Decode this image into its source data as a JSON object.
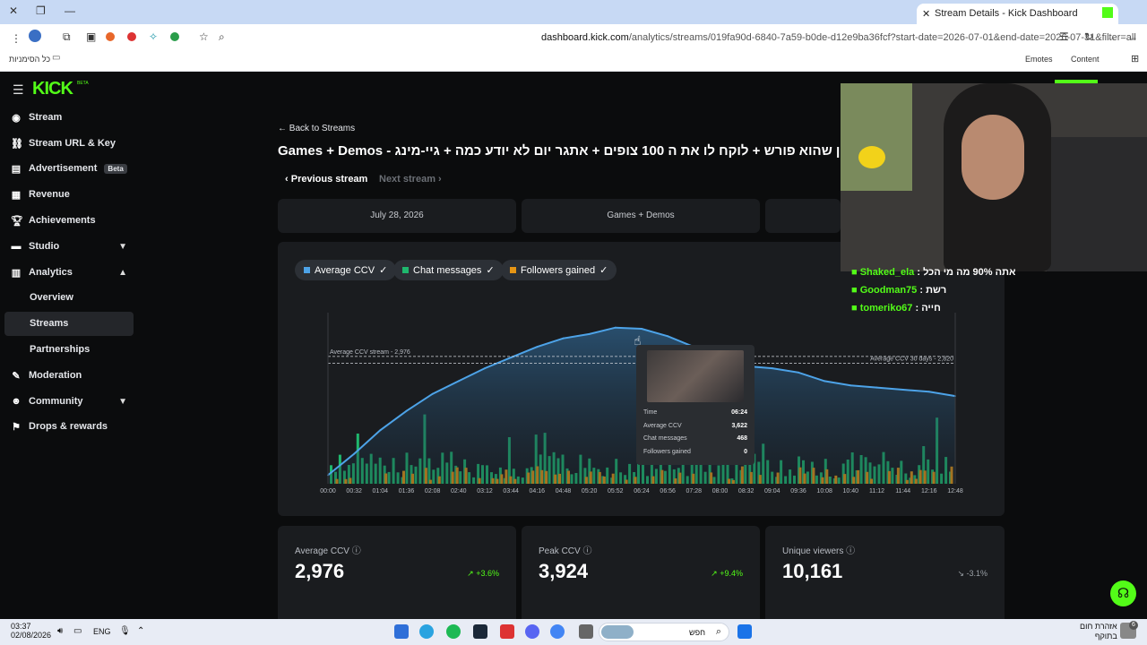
{
  "browser": {
    "tab_title": "Stream Details - Kick Dashboard",
    "url_domain": "dashboard.kick.com",
    "url_path": "/analytics/streams/019fa90d-6840-7a59-b0de-d12e9ba36fcf?start-date=2026-07-01&end-date=2026-07-31&filter=all",
    "bookmarks_label": "כל הסימניות",
    "right_links": [
      "Emotes",
      "Content"
    ]
  },
  "brand": {
    "logo": "KICK",
    "badge": "BETA"
  },
  "sidebar": {
    "items": [
      {
        "label": "Stream",
        "icon": "broadcast-icon"
      },
      {
        "label": "Stream URL & Key",
        "icon": "link-icon"
      },
      {
        "label": "Advertisement",
        "icon": "ad-icon",
        "badge": "Beta"
      },
      {
        "label": "Revenue",
        "icon": "revenue-icon"
      },
      {
        "label": "Achievements",
        "icon": "trophy-icon"
      },
      {
        "label": "Studio",
        "icon": "studio-icon"
      },
      {
        "label": "Analytics",
        "icon": "analytics-icon"
      },
      {
        "label": "Moderation",
        "icon": "wrench-icon"
      },
      {
        "label": "Community",
        "icon": "community-icon"
      },
      {
        "label": "Drops & rewards",
        "icon": "drops-icon"
      }
    ],
    "analytics_sub": [
      "Overview",
      "Streams",
      "Partnerships"
    ]
  },
  "page": {
    "back": "Back to Streams",
    "title": "Games + Demos - אני לא מאמין שהוא פורש + לוקח לו את ה 100 צופים + אתגר יום לא יודע כמה + גיי-מינג",
    "prev": "Previous stream",
    "next": "Next stream",
    "info": [
      "July 28, 2026",
      "Games + Demos"
    ]
  },
  "filters": [
    "Average CCV",
    "Chat messages",
    "Followers gained"
  ],
  "colors": {
    "ccv": "#4da3e8",
    "chat": "#1fb86e",
    "followers": "#e69514",
    "accent": "#53fc18"
  },
  "chart_data": {
    "type": "line",
    "x": [
      "00:00",
      "00:32",
      "01:04",
      "01:36",
      "02:08",
      "02:40",
      "03:12",
      "03:44",
      "04:16",
      "04:48",
      "05:20",
      "05:52",
      "06:24",
      "06:56",
      "07:28",
      "08:00",
      "08:32",
      "09:04",
      "09:36",
      "10:08",
      "10:40",
      "11:12",
      "11:44",
      "12:16",
      "12:48"
    ],
    "series": [
      {
        "name": "Average CCV",
        "values": [
          200,
          700,
          1250,
          1700,
          2100,
          2400,
          2700,
          2950,
          3200,
          3400,
          3500,
          3650,
          3622,
          3450,
          3200,
          2850,
          2750,
          2700,
          2600,
          2400,
          2300,
          2250,
          2200,
          2150,
          2050
        ]
      }
    ],
    "reference_lines": [
      {
        "label": "Average CCV stream - 2,976",
        "value": 2976
      },
      {
        "label": "Average CCV 30 days - 2,820",
        "value": 2820
      }
    ],
    "ylim": [
      0,
      4000
    ]
  },
  "tooltip": {
    "rows": [
      {
        "k": "Time",
        "v": "06:24"
      },
      {
        "k": "Average CCV",
        "v": "3,622"
      },
      {
        "k": "Chat messages",
        "v": "468"
      },
      {
        "k": "Followers gained",
        "v": "0"
      }
    ]
  },
  "stats": [
    {
      "label": "Average CCV",
      "value": "2,976",
      "delta": "+3.6%"
    },
    {
      "label": "Peak CCV",
      "value": "3,924",
      "delta": "+9.4%"
    },
    {
      "label": "Unique viewers",
      "value": "10,161",
      "delta": "-3.1%"
    }
  ],
  "chat": [
    {
      "user": "Shaked_ela",
      "msg": "אתה 90% מה מי הכל"
    },
    {
      "user": "Goodman75",
      "msg": "רשת"
    },
    {
      "user": "tomeriko67",
      "msg": "חייה"
    }
  ],
  "taskbar": {
    "time": "03:37",
    "date": "02/08/2026",
    "lang": "ENG",
    "search": "חפש",
    "weather": "אזהרת חום",
    "weather2": "בתוקף",
    "notif": "6"
  }
}
